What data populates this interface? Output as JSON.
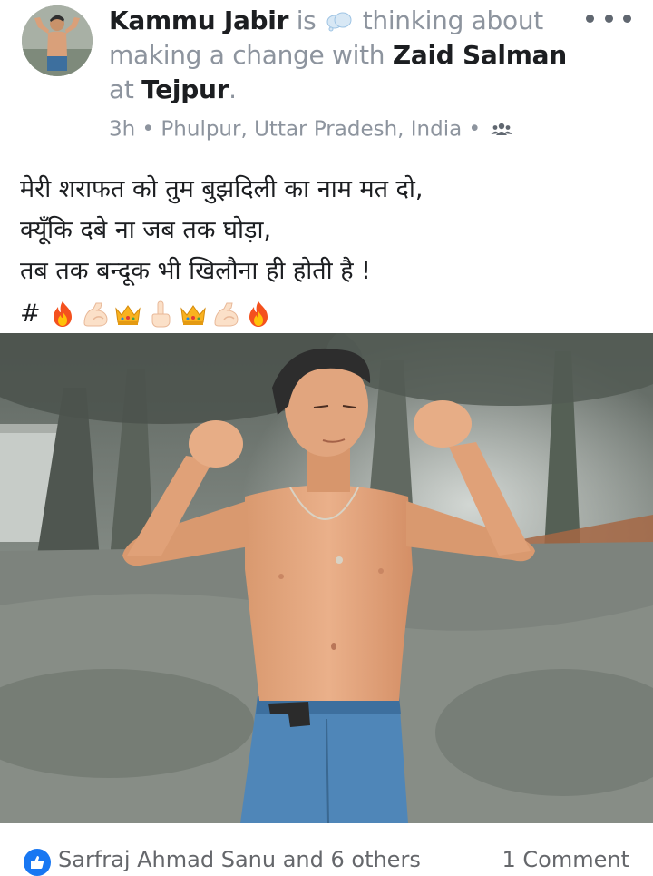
{
  "post": {
    "author": "Kammu Jabir",
    "verb": "is",
    "activity": "thinking about making a change with",
    "tagged": "Zaid Salman",
    "place_prefix": "at",
    "place": "Tejpur",
    "place_suffix": ".",
    "time": "3h",
    "separator": "•",
    "location": "Phulpur, Uttar Pradesh, India",
    "audience_icon": "friends-icon",
    "more_icon": "more-options-icon"
  },
  "content": {
    "lines": [
      "मेरी शराफत को तुम बुझदिली का नाम मत दो,",
      "क्यूँकि दबे ना जब तक घोड़ा,",
      "तब तक बन्दूक भी खिलौना ही होती है !"
    ],
    "hash": "#",
    "emojis": [
      "fire-emoji",
      "flexed-biceps-emoji",
      "crown-emoji",
      "pointing-up-emoji",
      "crown-emoji",
      "flexed-biceps-emoji",
      "fire-emoji"
    ]
  },
  "footer": {
    "reactors": "Sarfraj Ahmad Sanu and 6 others",
    "comments": "1 Comment",
    "like_color": "#1877f2"
  }
}
